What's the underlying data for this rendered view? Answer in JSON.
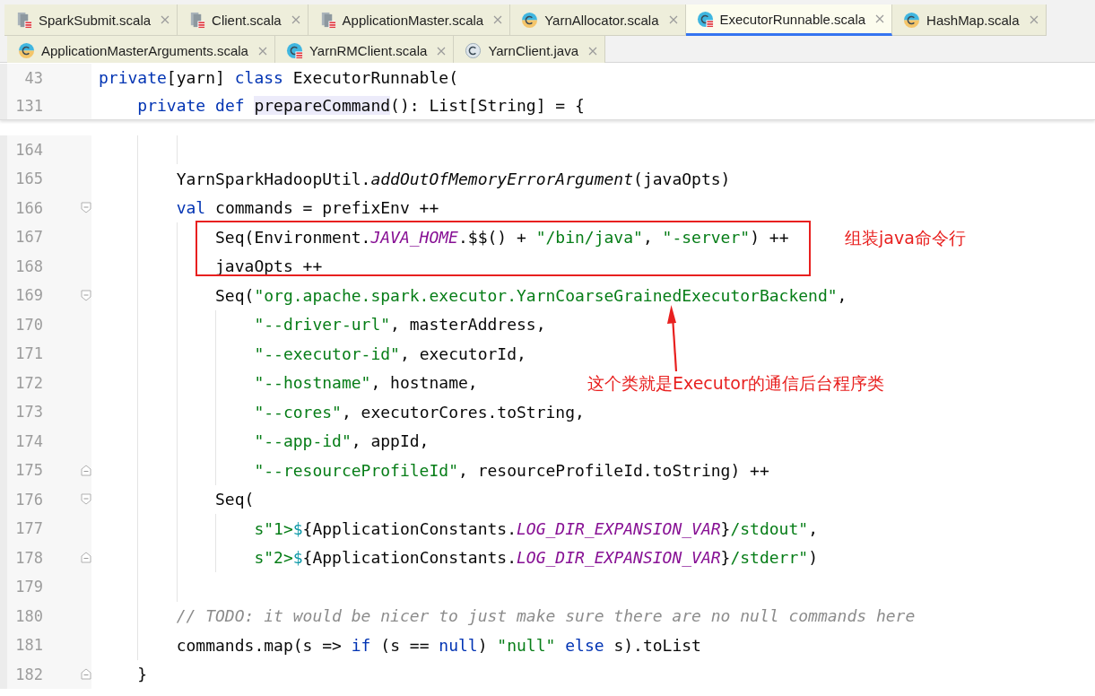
{
  "tab_rows": [
    {
      "tabs": [
        {
          "label": "SparkSubmit.scala",
          "kind": "object",
          "selected": false
        },
        {
          "label": "Client.scala",
          "kind": "object",
          "selected": false
        },
        {
          "label": "ApplicationMaster.scala",
          "kind": "object",
          "selected": false
        },
        {
          "label": "YarnAllocator.scala",
          "kind": "class",
          "selected": false
        },
        {
          "label": "ExecutorRunnable.scala",
          "kind": "companion",
          "selected": true
        },
        {
          "label": "HashMap.scala",
          "kind": "class",
          "selected": false
        }
      ]
    },
    {
      "tabs": [
        {
          "label": "ApplicationMasterArguments.scala",
          "kind": "class",
          "selected": false
        },
        {
          "label": "YarnRMClient.scala",
          "kind": "companion",
          "selected": false
        },
        {
          "label": "YarnClient.java",
          "kind": "java",
          "selected": false
        }
      ]
    }
  ],
  "sticky_header": [
    {
      "number": "43",
      "tokens": [
        {
          "text": "private",
          "kind": "keyword"
        },
        {
          "text": "[yarn] ",
          "kind": "plain"
        },
        {
          "text": "class",
          "kind": "keyword"
        },
        {
          "text": " ExecutorRunnable(",
          "kind": "plain"
        }
      ]
    },
    {
      "number": "131",
      "tokens": [
        {
          "text": "    private def ",
          "kind": "keyword"
        },
        {
          "text": "prepareCommand",
          "kind": "highlight"
        },
        {
          "text": "(): List[String] = {",
          "kind": "plain"
        }
      ]
    }
  ],
  "lines": [
    {
      "number": "164",
      "fold_start": false,
      "fold_end": false
    },
    {
      "number": "165",
      "fold_start": false,
      "fold_end": false,
      "tokens": [
        {
          "text": "        YarnSparkHadoopUtil.",
          "kind": "plain"
        },
        {
          "text": "addOutOfMemoryErrorArgument",
          "kind": "call"
        },
        {
          "text": "(javaOpts)",
          "kind": "plain"
        }
      ]
    },
    {
      "number": "166",
      "fold_start": true,
      "fold_end": false,
      "tokens": [
        {
          "text": "        val",
          "kind": "keyword"
        },
        {
          "text": " commands = prefixEnv ++",
          "kind": "plain"
        }
      ]
    },
    {
      "number": "167",
      "fold_start": false,
      "fold_end": false,
      "tokens": [
        {
          "text": "            Seq(Environment.",
          "kind": "plain"
        },
        {
          "text": "JAVA_HOME",
          "kind": "constant"
        },
        {
          "text": ".$$() + ",
          "kind": "plain"
        },
        {
          "text": "\"/bin/java\"",
          "kind": "string"
        },
        {
          "text": ", ",
          "kind": "plain"
        },
        {
          "text": "\"-server\"",
          "kind": "string"
        },
        {
          "text": ") ++",
          "kind": "plain"
        }
      ]
    },
    {
      "number": "168",
      "fold_start": false,
      "fold_end": false,
      "tokens": [
        {
          "text": "            javaOpts ++",
          "kind": "plain"
        }
      ]
    },
    {
      "number": "169",
      "fold_start": true,
      "fold_end": false,
      "tokens": [
        {
          "text": "            Seq(",
          "kind": "plain"
        },
        {
          "text": "\"org.apache.spark.executor.YarnCoarseGrainedExecutorBackend\"",
          "kind": "string"
        },
        {
          "text": ",",
          "kind": "plain"
        }
      ]
    },
    {
      "number": "170",
      "fold_start": false,
      "fold_end": false,
      "tokens": [
        {
          "text": "                \"--driver-url\"",
          "kind": "string"
        },
        {
          "text": ", masterAddress,",
          "kind": "plain"
        }
      ]
    },
    {
      "number": "171",
      "fold_start": false,
      "fold_end": false,
      "tokens": [
        {
          "text": "                \"--executor-id\"",
          "kind": "string"
        },
        {
          "text": ", executorId,",
          "kind": "plain"
        }
      ]
    },
    {
      "number": "172",
      "fold_start": false,
      "fold_end": false,
      "tokens": [
        {
          "text": "                \"--hostname\"",
          "kind": "string"
        },
        {
          "text": ", hostname,",
          "kind": "plain"
        }
      ]
    },
    {
      "number": "173",
      "fold_start": false,
      "fold_end": false,
      "tokens": [
        {
          "text": "                \"--cores\"",
          "kind": "string"
        },
        {
          "text": ", executorCores.toString,",
          "kind": "plain"
        }
      ]
    },
    {
      "number": "174",
      "fold_start": false,
      "fold_end": false,
      "tokens": [
        {
          "text": "                \"--app-id\"",
          "kind": "string"
        },
        {
          "text": ", appId,",
          "kind": "plain"
        }
      ]
    },
    {
      "number": "175",
      "fold_start": false,
      "fold_end": true,
      "tokens": [
        {
          "text": "                \"--resourceProfileId\"",
          "kind": "string"
        },
        {
          "text": ", resourceProfileId.toString) ++",
          "kind": "plain"
        }
      ]
    },
    {
      "number": "176",
      "fold_start": true,
      "fold_end": false,
      "tokens": [
        {
          "text": "            Seq(",
          "kind": "plain"
        }
      ]
    },
    {
      "number": "177",
      "fold_start": false,
      "fold_end": false,
      "tokens": [
        {
          "text": "                s\"1>",
          "kind": "string"
        },
        {
          "text": "$",
          "kind": "interp"
        },
        {
          "text": "{ApplicationConstants.",
          "kind": "plain"
        },
        {
          "text": "LOG_DIR_EXPANSION_VAR",
          "kind": "constant"
        },
        {
          "text": "}",
          "kind": "plain"
        },
        {
          "text": "/stdout\"",
          "kind": "string"
        },
        {
          "text": ",",
          "kind": "plain"
        }
      ]
    },
    {
      "number": "178",
      "fold_start": false,
      "fold_end": true,
      "tokens": [
        {
          "text": "                s\"2>",
          "kind": "string"
        },
        {
          "text": "$",
          "kind": "interp"
        },
        {
          "text": "{ApplicationConstants.",
          "kind": "plain"
        },
        {
          "text": "LOG_DIR_EXPANSION_VAR",
          "kind": "constant"
        },
        {
          "text": "}",
          "kind": "plain"
        },
        {
          "text": "/stderr\"",
          "kind": "string"
        },
        {
          "text": ")",
          "kind": "plain"
        }
      ]
    },
    {
      "number": "179",
      "fold_start": false,
      "fold_end": false
    },
    {
      "number": "180",
      "fold_start": false,
      "fold_end": false,
      "tokens": [
        {
          "text": "        // TODO: it would be nicer to just make sure there are no null commands here",
          "kind": "comment"
        }
      ]
    },
    {
      "number": "181",
      "fold_start": false,
      "fold_end": false,
      "tokens": [
        {
          "text": "        commands.map(s => ",
          "kind": "plain"
        },
        {
          "text": "if",
          "kind": "keyword"
        },
        {
          "text": " (s == ",
          "kind": "plain"
        },
        {
          "text": "null",
          "kind": "keyword"
        },
        {
          "text": ") ",
          "kind": "plain"
        },
        {
          "text": "\"null\" ",
          "kind": "string"
        },
        {
          "text": "else",
          "kind": "keyword"
        },
        {
          "text": " s).toList",
          "kind": "plain"
        }
      ]
    },
    {
      "number": "182",
      "fold_start": false,
      "fold_end": true,
      "tokens": [
        {
          "text": "    }",
          "kind": "plain"
        }
      ]
    }
  ],
  "callouts": [
    {
      "kind": "boxed",
      "text": "组装java命令行"
    },
    {
      "kind": "arrow",
      "text": "这个类就是Executor的通信后台程序类"
    }
  ]
}
